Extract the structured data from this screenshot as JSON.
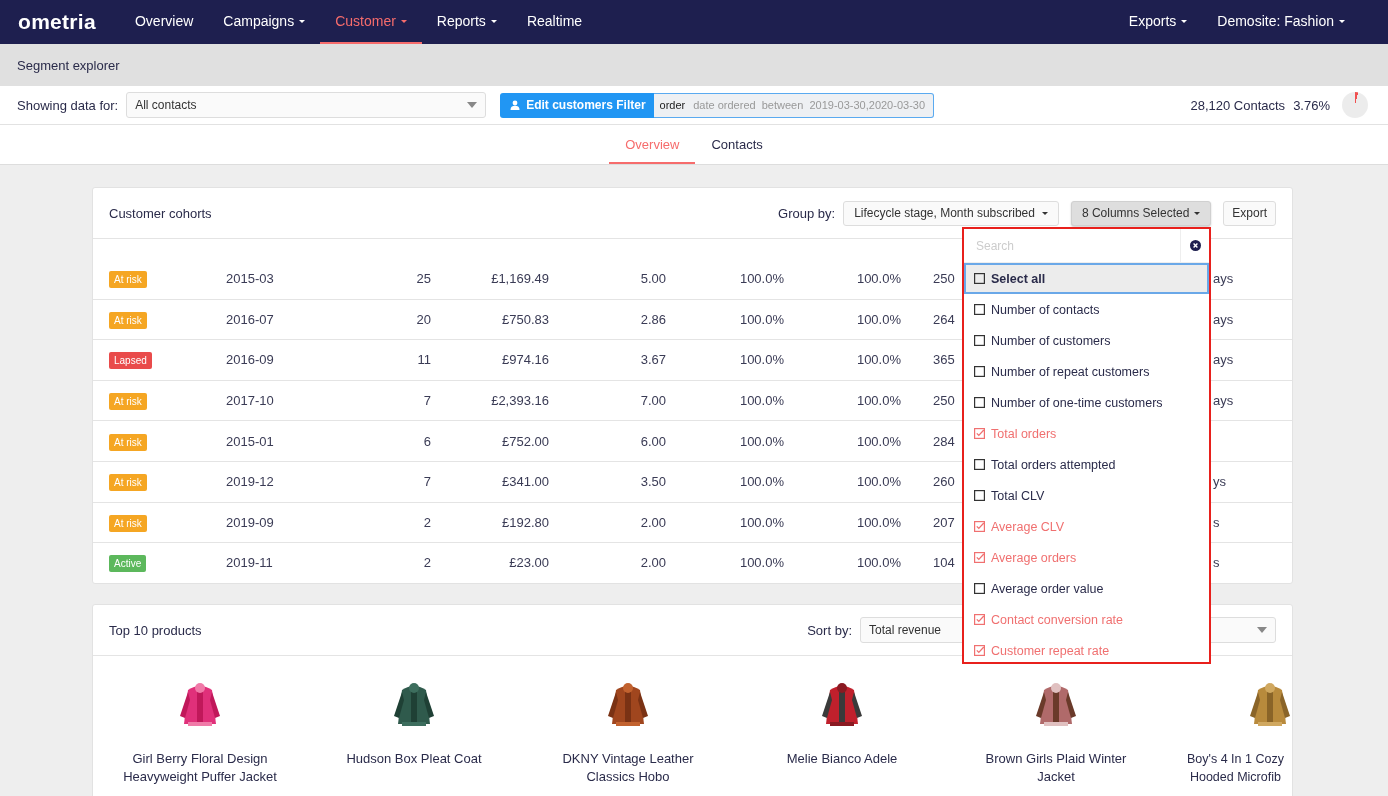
{
  "nav": {
    "logo": "ometria",
    "items": [
      {
        "label": "Overview",
        "caret": false,
        "selected": false
      },
      {
        "label": "Campaigns",
        "caret": true,
        "selected": false
      },
      {
        "label": "Customer",
        "caret": true,
        "selected": true
      },
      {
        "label": "Reports",
        "caret": true,
        "selected": false
      },
      {
        "label": "Realtime",
        "caret": false,
        "selected": false
      }
    ],
    "right_items": [
      {
        "label": "Exports",
        "caret": true
      },
      {
        "label": "Demosite: Fashion",
        "caret": true
      }
    ]
  },
  "page_title": "Segment explorer",
  "filter": {
    "label": "Showing data for:",
    "segment": "All contacts",
    "button": "Edit customers Filter",
    "tag_kind": "order",
    "tag_text": "date ordered  between  2019-03-30,2020-03-30",
    "contacts": "28,120 Contacts",
    "percent": "3.76%"
  },
  "tabs": [
    {
      "label": "Overview",
      "selected": true
    },
    {
      "label": "Contacts",
      "selected": false
    }
  ],
  "cohorts": {
    "title": "Customer cohorts",
    "group_by_label": "Group by:",
    "group_by": "Lifecycle stage, Month subscribed",
    "columns_button": "8 Columns Selected",
    "export": "Export",
    "rows": [
      {
        "stage": "At risk",
        "color": "#f5a623",
        "cells": [
          "2015-03",
          "25",
          "£1,169.49",
          "5.00",
          "100.0%",
          "100.0%",
          "250",
          "ays"
        ]
      },
      {
        "stage": "At risk",
        "color": "#f5a623",
        "cells": [
          "2016-07",
          "20",
          "£750.83",
          "2.86",
          "100.0%",
          "100.0%",
          "264",
          "ays"
        ]
      },
      {
        "stage": "Lapsed",
        "color": "#e94b4b",
        "cells": [
          "2016-09",
          "11",
          "£974.16",
          "3.67",
          "100.0%",
          "100.0%",
          "365",
          "ays"
        ]
      },
      {
        "stage": "At risk",
        "color": "#f5a623",
        "cells": [
          "2017-10",
          "7",
          "£2,393.16",
          "7.00",
          "100.0%",
          "100.0%",
          "250",
          "ays"
        ]
      },
      {
        "stage": "At risk",
        "color": "#f5a623",
        "cells": [
          "2015-01",
          "6",
          "£752.00",
          "6.00",
          "100.0%",
          "100.0%",
          "284",
          ""
        ]
      },
      {
        "stage": "At risk",
        "color": "#f5a623",
        "cells": [
          "2019-12",
          "7",
          "£341.00",
          "3.50",
          "100.0%",
          "100.0%",
          "260",
          "ys"
        ]
      },
      {
        "stage": "At risk",
        "color": "#f5a623",
        "cells": [
          "2019-09",
          "2",
          "£192.80",
          "2.00",
          "100.0%",
          "100.0%",
          "207",
          "s"
        ]
      },
      {
        "stage": "Active",
        "color": "#5cb85c",
        "cells": [
          "2019-11",
          "2",
          "£23.00",
          "2.00",
          "100.0%",
          "100.0%",
          "104",
          "s"
        ]
      }
    ]
  },
  "columns_menu": {
    "placeholder": "Search",
    "items": [
      {
        "label": "Select all",
        "checked": false,
        "selected": true
      },
      {
        "label": "Number of contacts",
        "checked": false,
        "selected": false
      },
      {
        "label": "Number of customers",
        "checked": false,
        "selected": false
      },
      {
        "label": "Number of repeat customers",
        "checked": false,
        "selected": false
      },
      {
        "label": "Number of one-time customers",
        "checked": false,
        "selected": false
      },
      {
        "label": "Total orders",
        "checked": true,
        "selected": false
      },
      {
        "label": "Total orders attempted",
        "checked": false,
        "selected": false
      },
      {
        "label": "Total CLV",
        "checked": false,
        "selected": false
      },
      {
        "label": "Average CLV",
        "checked": true,
        "selected": false
      },
      {
        "label": "Average orders",
        "checked": true,
        "selected": false
      },
      {
        "label": "Average order value",
        "checked": false,
        "selected": false
      },
      {
        "label": "Contact conversion rate",
        "checked": true,
        "selected": false
      },
      {
        "label": "Customer repeat rate",
        "checked": true,
        "selected": false
      }
    ]
  },
  "products": {
    "title": "Top 10 products",
    "sort_label": "Sort by:",
    "sort_value": "Total revenue",
    "items": [
      {
        "lines": [
          "Girl Berry Floral Design",
          "Heavyweight Puffer Jacket"
        ],
        "kind": "picture"
      },
      {
        "lines": [
          "Hudson Box Pleat Coat"
        ],
        "kind": "picture"
      },
      {
        "lines": [
          "DKNY Vintage Leather",
          "Classics Hobo"
        ],
        "kind": "picture"
      },
      {
        "lines": [
          "Melie Bianco Adele"
        ],
        "kind": "picture"
      },
      {
        "lines": [
          "Brown Girls Plaid Winter",
          "Jacket"
        ],
        "kind": "picture"
      },
      {
        "lines": [
          "Boy's 4 In 1 Cozy",
          "Hooded Microfib"
        ],
        "kind": "picture"
      }
    ]
  }
}
